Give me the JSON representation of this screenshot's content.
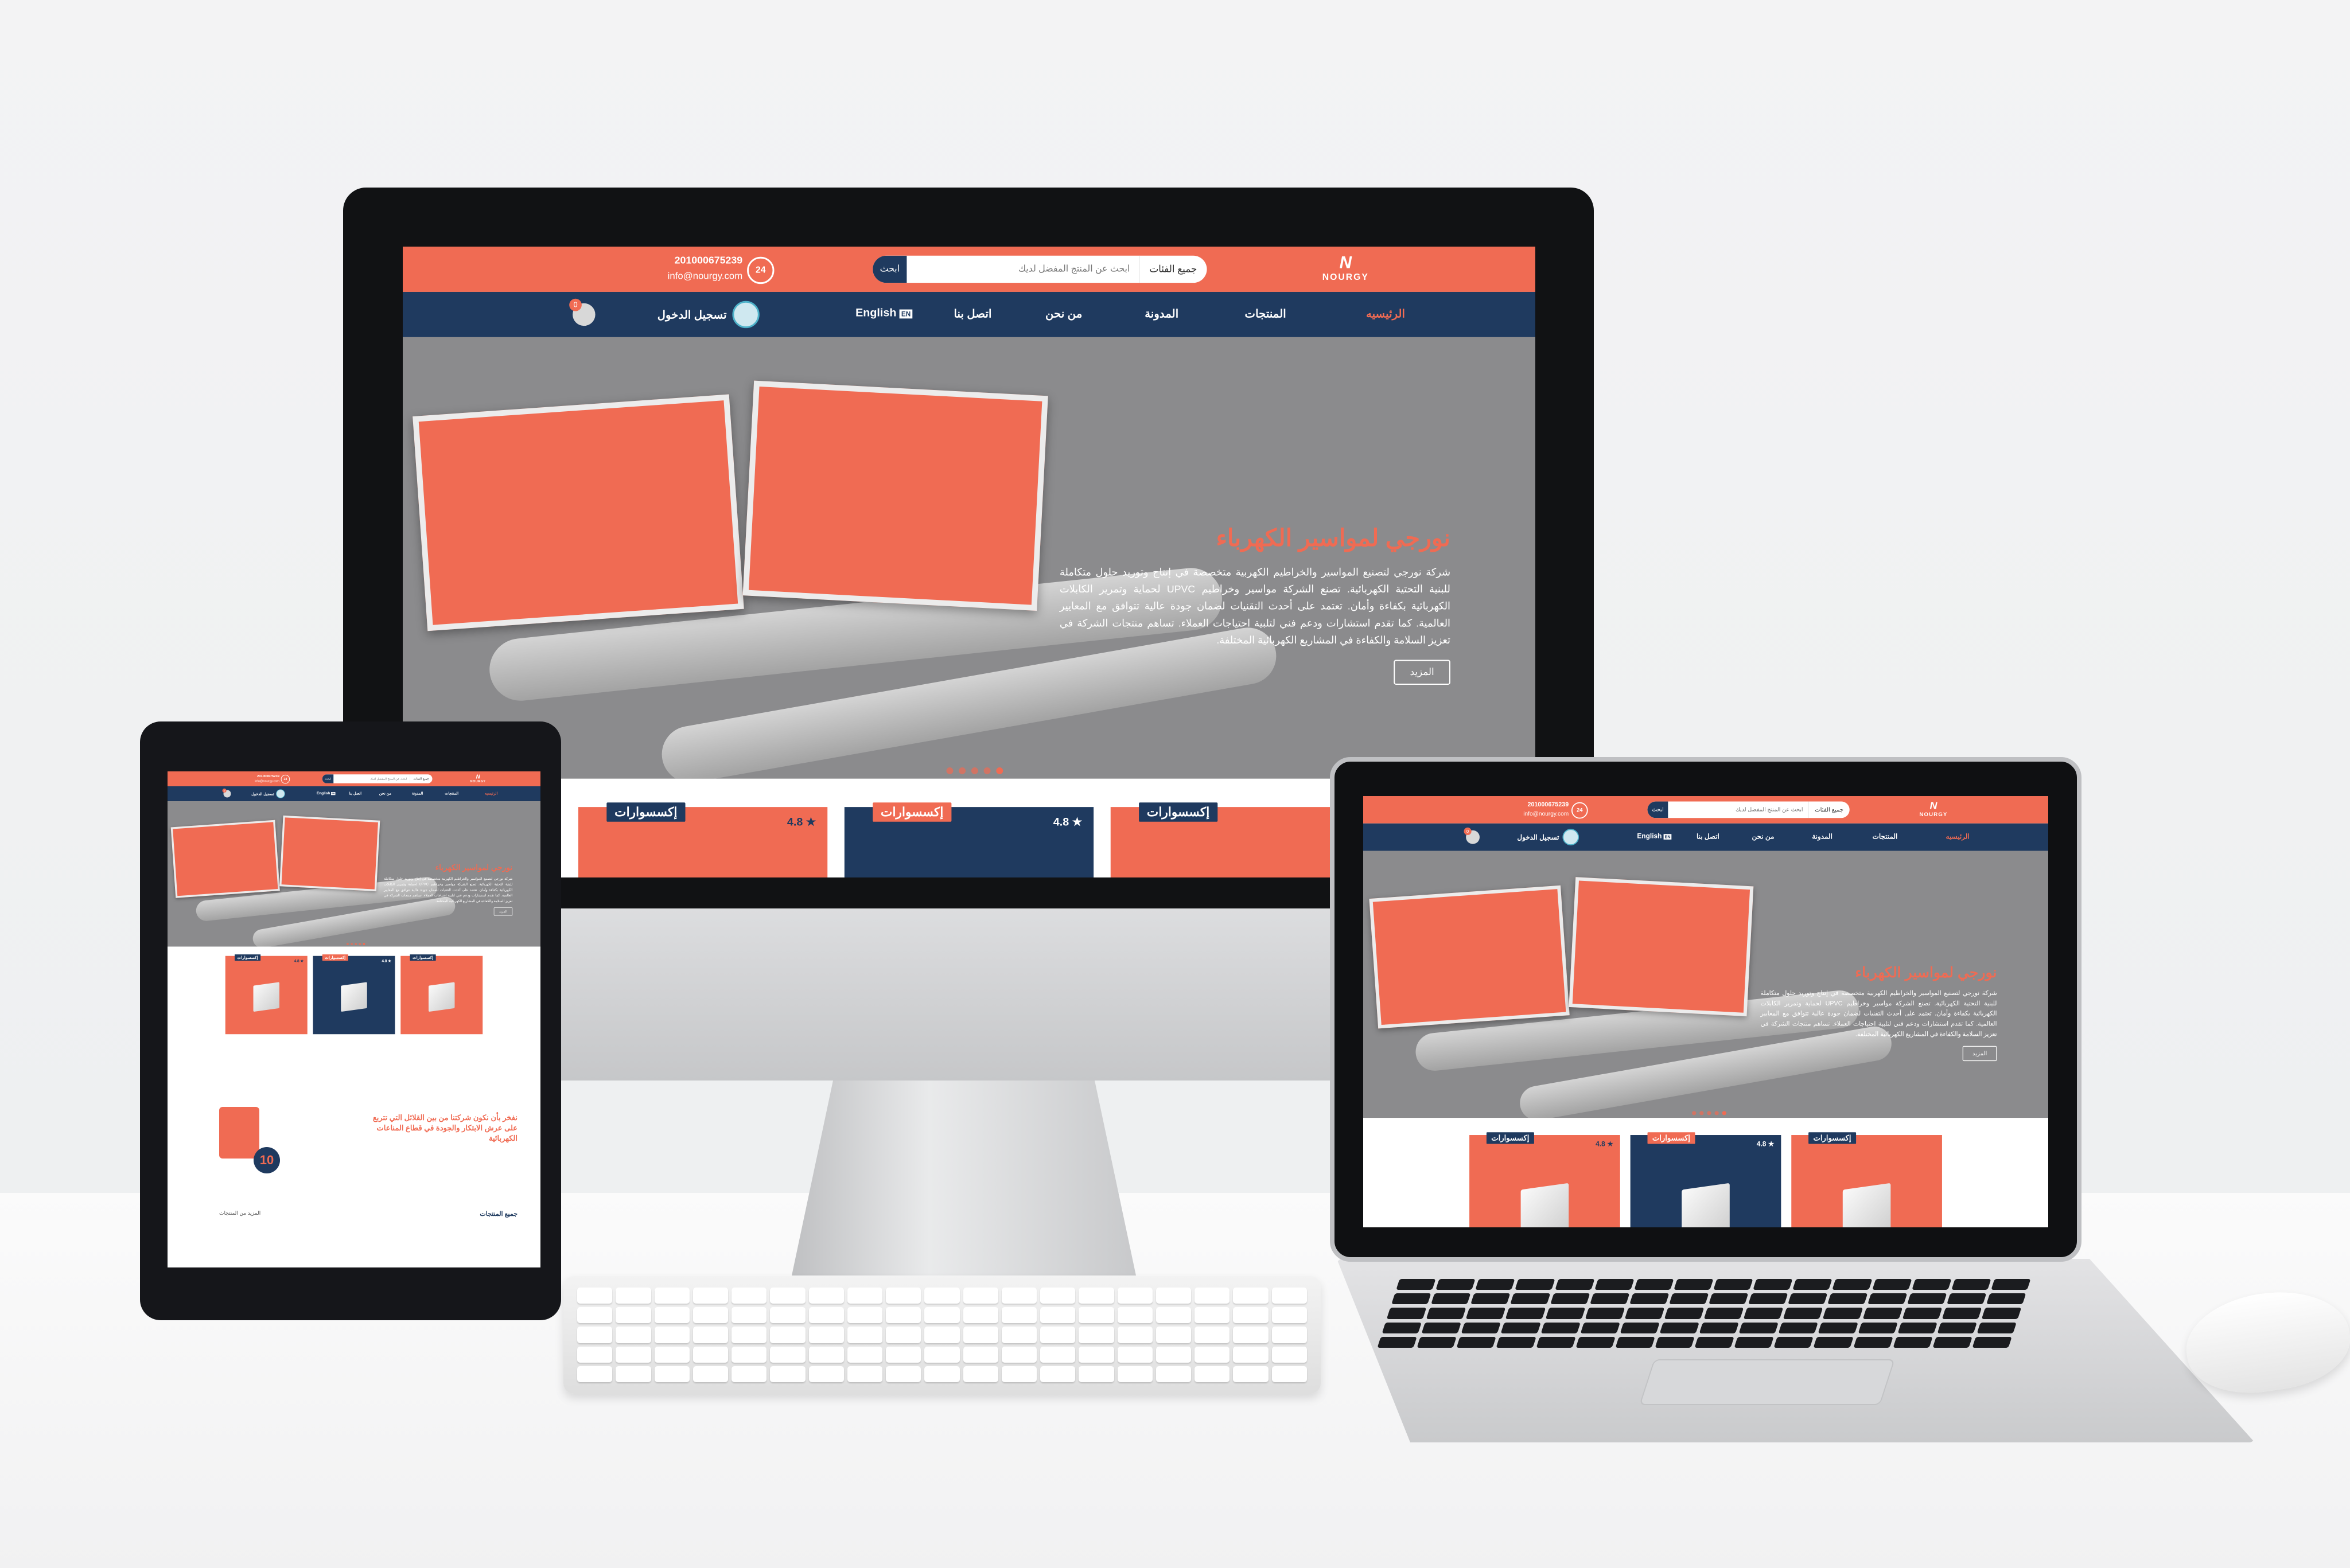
{
  "site": {
    "brand": "NOURGY",
    "brand_mark": "N",
    "phone": "201000675239",
    "email": "info@nourgy.com",
    "support_badge": "24",
    "search": {
      "category": "جميع الفئات",
      "placeholder": "ابحث عن المنتج المفضل لديك",
      "button": "ابحث"
    },
    "nav": [
      "الرئيسيه",
      "المنتجات",
      "المدونة",
      "من نحن",
      "اتصل بنا",
      "English"
    ],
    "lang_flag": "EN",
    "login": "تسجيل الدخول",
    "cart_count": "0",
    "hero": {
      "title": "نورجي لمواسير الكهرباء",
      "text": "شركة نورجي لتصنيع المواسير والخراطيم الكهربية متخصصة في إنتاج وتوريد حلول متكاملة للبنية التحتية الكهربائية. تصنع الشركة مواسير وخراطيم UPVC لحماية وتمرير الكابلات الكهربائية بكفاءة وأمان. تعتمد على أحدث التقنيات لضمان جودة عالية تتوافق مع المعايير العالمية. كما تقدم استشارات ودعم فني لتلبية احتياجات العملاء. تساهم منتجات الشركة في تعزيز السلامة والكفاءة في المشاريع الكهربائية المختلفة.",
      "button": "المزيد"
    },
    "products": [
      {
        "tag": "إكسسوارات",
        "rating": "4.8",
        "style": "o"
      },
      {
        "tag": "إكسسوارات",
        "rating": "4.8",
        "style": "b"
      },
      {
        "tag": "إكسسوارات",
        "rating": "",
        "style": "o"
      }
    ],
    "colors": {
      "accent": "#f06b53",
      "navy": "#1f3a5f"
    }
  },
  "tablet_extra": {
    "about_title": "نفخر بأن نكون شركتنا من بين القلائل التي تتربع على عرش الابتكار والجودة في قطاع المناعات الكهربائية",
    "years_badge": "10",
    "all_products": "جميع المنتجات",
    "more_products": "المزيد من المنتجات"
  }
}
